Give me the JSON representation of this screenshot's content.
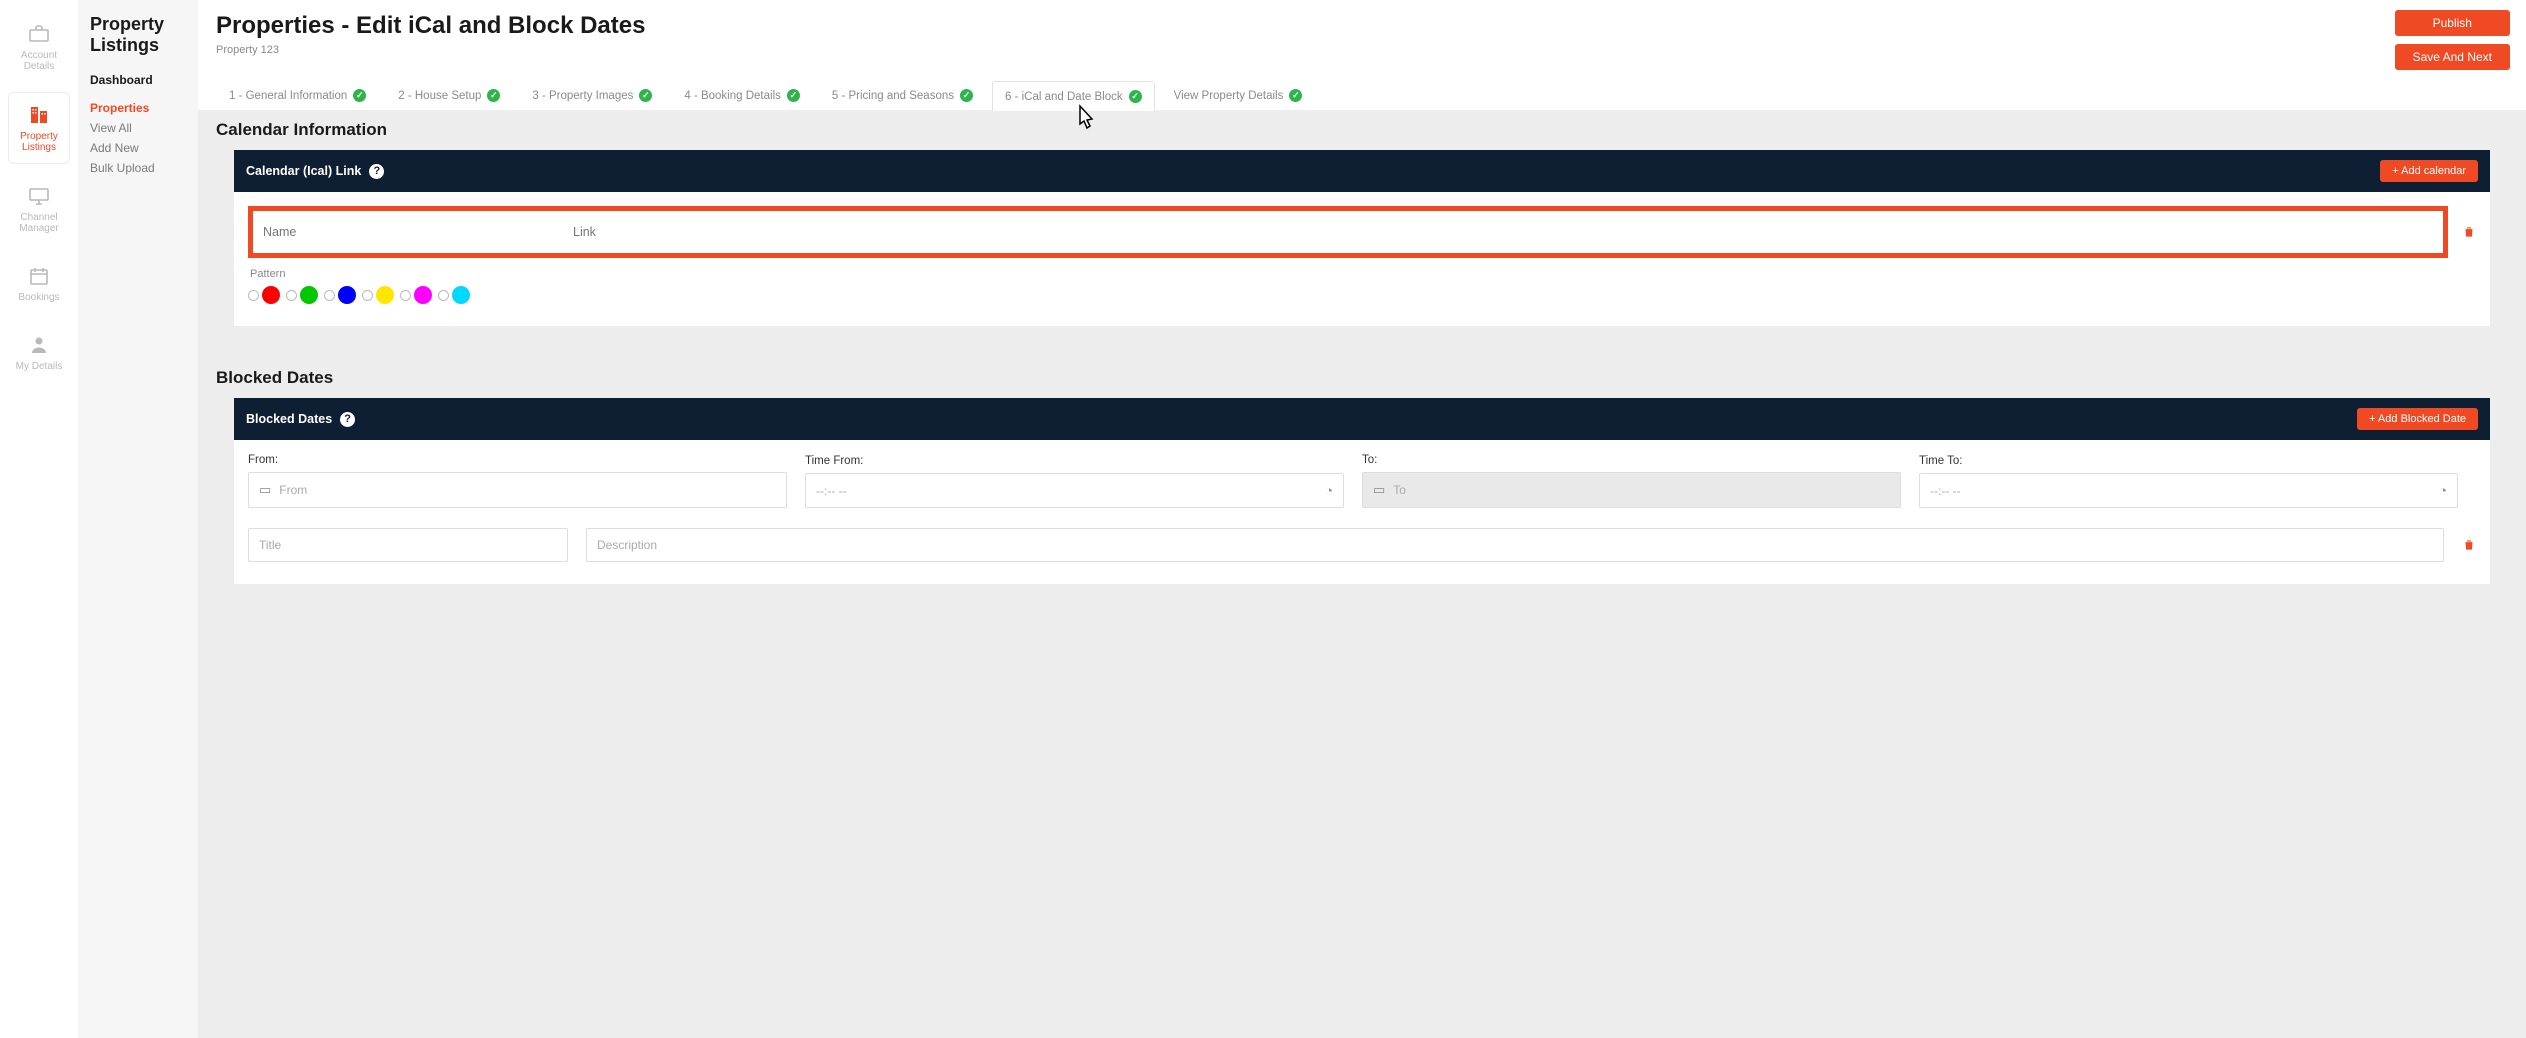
{
  "rail": [
    {
      "label": "Account Details",
      "icon": "briefcase",
      "active": false
    },
    {
      "label": "Property Listings",
      "icon": "building",
      "active": true
    },
    {
      "label": "Channel Manager",
      "icon": "monitor",
      "active": false
    },
    {
      "label": "Bookings",
      "icon": "calendar",
      "active": false
    },
    {
      "label": "My Details",
      "icon": "user",
      "active": false
    }
  ],
  "sidebar": {
    "title": "Property Listings",
    "items": [
      {
        "label": "Dashboard",
        "kind": "bold"
      },
      {
        "label": "Properties",
        "kind": "active"
      },
      {
        "label": "View All",
        "kind": "sub"
      },
      {
        "label": "Add New",
        "kind": "sub"
      },
      {
        "label": "Bulk Upload",
        "kind": "sub"
      }
    ]
  },
  "header": {
    "title": "Properties - Edit iCal and Block Dates",
    "breadcrumb": "Property 123",
    "publish": "Publish",
    "save_next": "Save And Next"
  },
  "tabs": [
    {
      "label": "1 - General Information"
    },
    {
      "label": "2 - House Setup"
    },
    {
      "label": "3 - Property Images"
    },
    {
      "label": "4 - Booking Details"
    },
    {
      "label": "5 - Pricing and Seasons"
    },
    {
      "label": "6 - iCal and Date Block",
      "active": true
    },
    {
      "label": "View Property Details"
    }
  ],
  "calendar_section": {
    "heading": "Calendar Information",
    "bar_title": "Calendar (Ical) Link",
    "add_btn": "+ Add calendar",
    "name_ph": "Name",
    "link_ph": "Link",
    "pattern_label": "Pattern",
    "colors": [
      "#ff0000",
      "#00c800",
      "#0000ff",
      "#ffe600",
      "#ff00ff",
      "#00d8ff"
    ]
  },
  "blocked_section": {
    "heading": "Blocked Dates",
    "bar_title": "Blocked Dates",
    "add_btn": "+ Add Blocked Date",
    "from_label": "From:",
    "from_ph": "From",
    "timefrom_label": "Time From:",
    "time_ph": "--:-- --",
    "to_label": "To:",
    "to_ph": "To",
    "timeto_label": "Time To:",
    "title_ph": "Title",
    "desc_ph": "Description"
  }
}
